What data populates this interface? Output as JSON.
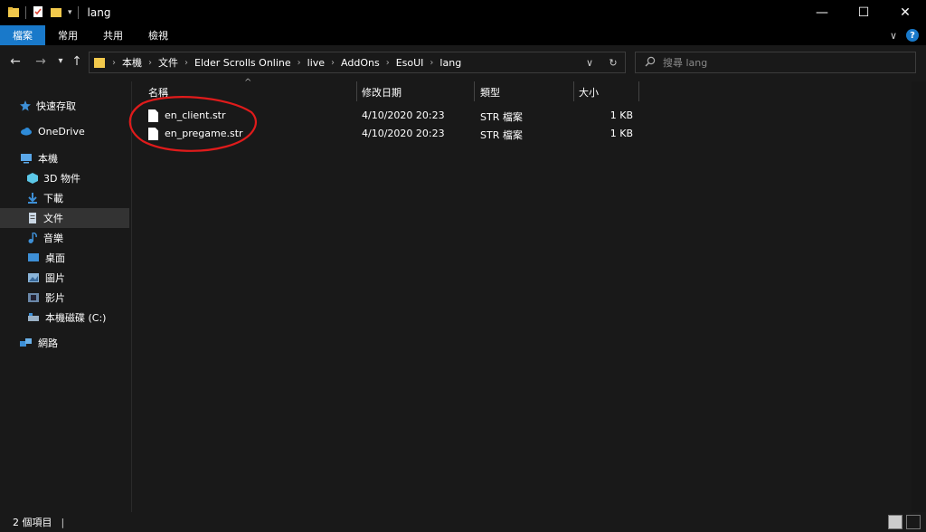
{
  "window": {
    "title": "lang",
    "controls": {
      "minimize": "—",
      "maximize": "☐",
      "close": "✕"
    }
  },
  "ribbon": {
    "tabs": [
      "檔案",
      "常用",
      "共用",
      "檢視"
    ],
    "active_tab": "檔案",
    "expand_icon": "∨",
    "help": "?"
  },
  "nav": {
    "back": "←",
    "forward": "→",
    "recent": "▾",
    "up": "↑",
    "breadcrumb": [
      "本機",
      "文件",
      "Elder Scrolls Online",
      "live",
      "AddOns",
      "EsoUI",
      "lang"
    ],
    "dropdown": "∨",
    "refresh": "↻"
  },
  "search": {
    "placeholder": "搜尋 lang"
  },
  "sidebar": {
    "items": [
      {
        "label": "快速存取",
        "icon": "star-icon",
        "color": "#3d8fd6"
      },
      {
        "label": "OneDrive",
        "icon": "cloud-icon",
        "color": "#2e8bd8"
      },
      {
        "label": "本機",
        "icon": "computer-icon",
        "color": "#5aa7e8"
      },
      {
        "label": "3D 物件",
        "icon": "cube-icon",
        "color": "#5cc8e8"
      },
      {
        "label": "下載",
        "icon": "download-arrow-icon",
        "color": "#3d8fd6"
      },
      {
        "label": "文件",
        "icon": "document-icon",
        "color": "#c9d6e3"
      },
      {
        "label": "音樂",
        "icon": "music-note-icon",
        "color": "#3d8fd6"
      },
      {
        "label": "桌面",
        "icon": "desktop-icon",
        "color": "#3d8fd6"
      },
      {
        "label": "圖片",
        "icon": "picture-icon",
        "color": "#8ab4d8"
      },
      {
        "label": "影片",
        "icon": "film-icon",
        "color": "#6a87a8"
      },
      {
        "label": "本機磁碟 (C:)",
        "icon": "drive-icon",
        "color": "#9ab0c4"
      },
      {
        "label": "網路",
        "icon": "network-icon",
        "color": "#3d8fd6"
      }
    ],
    "selected": "文件"
  },
  "columns": {
    "name": "名稱",
    "modified": "修改日期",
    "type": "類型",
    "size": "大小",
    "sort_caret": "^"
  },
  "files": [
    {
      "name": "en_client.str",
      "modified": "4/10/2020 20:23",
      "type": "STR 檔案",
      "size": "1 KB"
    },
    {
      "name": "en_pregame.str",
      "modified": "4/10/2020 20:23",
      "type": "STR 檔案",
      "size": "1 KB"
    }
  ],
  "annotation_color": "#e01b1b",
  "status": {
    "count": "2 個項目",
    "separator": "|"
  },
  "colors": {
    "accent": "#1979ca",
    "folder": "#f2c94c"
  }
}
